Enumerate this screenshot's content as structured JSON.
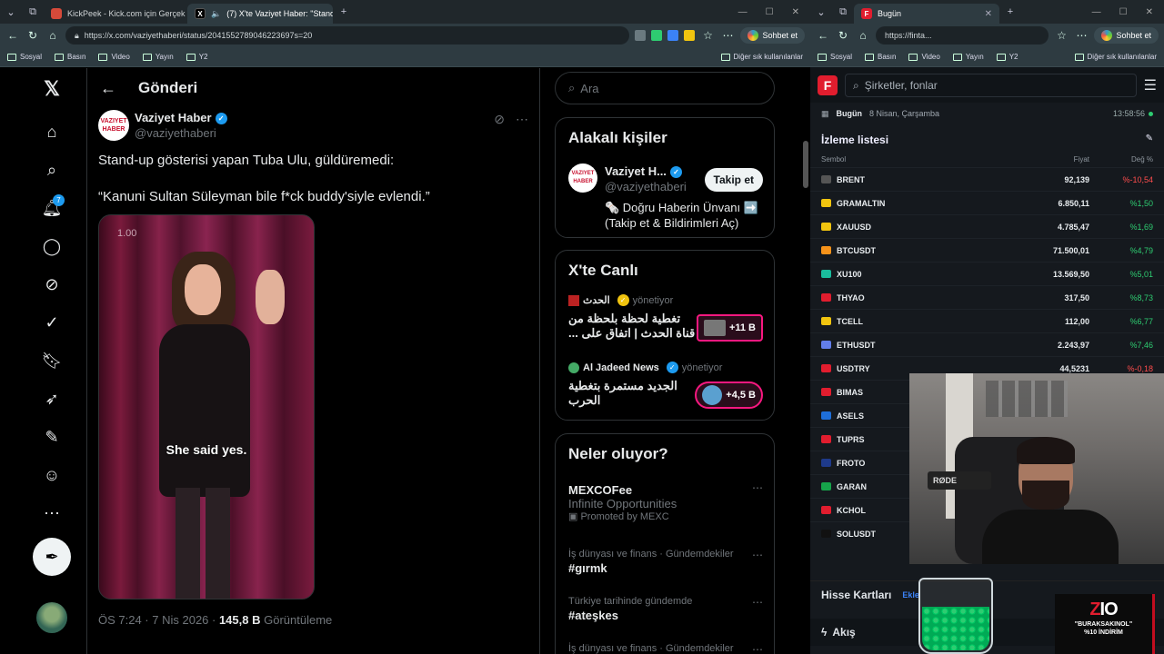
{
  "left_browser": {
    "tabs": [
      {
        "label": "KickPeek - Kick.com için Gerçek Za",
        "fav_color": "#d64a3a",
        "active": false
      },
      {
        "label": "(7) X'te Vaziyet Haber: \"Stand-",
        "fav_color": "#000000",
        "active": true
      }
    ],
    "url": "https://x.com/vaziyethaberi/status/2041552789046223697s=20",
    "copilot": "Sohbet et",
    "bookmarks": [
      "Sosyal",
      "Basın",
      "Video",
      "Yayın",
      "Y2"
    ],
    "bookmarks_other": "Diğer sık kullanılanlar"
  },
  "x": {
    "header_title": "Gönderi",
    "notif_count": "7",
    "author": {
      "name": "Vaziyet Haber",
      "handle": "@vaziyethaberi",
      "logo_text": "VAZIYET HABER"
    },
    "text1": "Stand-up gösterisi yapan Tuba Ulu, güldüremedi:",
    "text2": "“Kanuni Sultan Süleyman bile f*ck buddy'siyle evlendi.”",
    "video_time": "1.00",
    "video_caption": "She said yes.",
    "meta_time": "ÖS 7:24 · 7 Nis 2026 · ",
    "meta_views": "145,8 B",
    "meta_views_label": " Görüntüleme",
    "search_placeholder": "Ara",
    "related_title": "Alakalı kişiler",
    "related": {
      "name": "Vaziyet H...",
      "handle": "@vaziyethaberi",
      "follow": "Takip et",
      "bio": "🗞️ Doğru Haberin Ünvanı ➡️ (Takip et & Bildirimleri Aç)"
    },
    "live_title": "X'te Canlı",
    "live": [
      {
        "source": "الحدث",
        "suffix": "yönetiyor",
        "text": "تغطية لحظة بلحظة من قناة الحدث | اتفاق على ...",
        "count": "+11 B"
      },
      {
        "source": "Al Jadeed News",
        "suffix": "yönetiyor",
        "text": "الجديد مستمرة بتغطية الحرب",
        "count": "+4,5 B"
      }
    ],
    "trends_title": "Neler oluyor?",
    "promo": {
      "title": "MEXCOFee",
      "sub": "Infinite Opportunities",
      "ad": "Promoted by MEXC"
    },
    "trends": [
      {
        "cat": "İş dünyası ve finans · Gündemdekiler",
        "tag": "#gırmk"
      },
      {
        "cat": "Türkiye tarihinde gündemde",
        "tag": "#ateşkes"
      },
      {
        "cat": "İş dünyası ve finans · Gündemdekiler",
        "tag": ""
      }
    ]
  },
  "right_browser": {
    "tab": "Bugün",
    "url": "https://finta...",
    "copilot": "Sohbet et",
    "bookmarks": [
      "Sosyal",
      "Basın",
      "Video",
      "Yayın",
      "Y2"
    ],
    "bookmarks_other": "Diğer sık kullanılanlar"
  },
  "fin": {
    "search_placeholder": "Şirketler, fonlar",
    "today_label": "Bugün",
    "date": "8 Nisan, Çarşamba",
    "time": "13:58:56",
    "watchlist_title": "İzleme listesi",
    "col_symbol": "Sembol",
    "col_price": "Fiyat",
    "col_change": "Değ %",
    "rows": [
      {
        "sym": "BRENT",
        "price": "92,139",
        "chg": "%-10,54",
        "dir": "neg",
        "icon": "#555"
      },
      {
        "sym": "GRAMALTIN",
        "price": "6.850,11",
        "chg": "%1,50",
        "dir": "pos",
        "icon": "#f1c40f"
      },
      {
        "sym": "XAUUSD",
        "price": "4.785,47",
        "chg": "%1,69",
        "dir": "pos",
        "icon": "#f1c40f"
      },
      {
        "sym": "BTCUSDT",
        "price": "71.500,01",
        "chg": "%4,79",
        "dir": "pos",
        "icon": "#f7931a"
      },
      {
        "sym": "XU100",
        "price": "13.569,50",
        "chg": "%5,01",
        "dir": "pos",
        "icon": "#1abc9c"
      },
      {
        "sym": "THYAO",
        "price": "317,50",
        "chg": "%8,73",
        "dir": "pos",
        "icon": "#e11d2e"
      },
      {
        "sym": "TCELL",
        "price": "112,00",
        "chg": "%6,77",
        "dir": "pos",
        "icon": "#f1c40f"
      },
      {
        "sym": "ETHUSDT",
        "price": "2.243,97",
        "chg": "%7,46",
        "dir": "pos",
        "icon": "#627eea"
      },
      {
        "sym": "USDTRY",
        "price": "44,5231",
        "chg": "%-0,18",
        "dir": "neg",
        "icon": "#e11d2e"
      },
      {
        "sym": "BIMAS",
        "price": "",
        "chg": "",
        "dir": "pos",
        "icon": "#e11d2e"
      },
      {
        "sym": "ASELS",
        "price": "",
        "chg": "",
        "dir": "pos",
        "icon": "#1e6fd9"
      },
      {
        "sym": "TUPRS",
        "price": "",
        "chg": "",
        "dir": "pos",
        "icon": "#e11d2e"
      },
      {
        "sym": "FROTO",
        "price": "",
        "chg": "",
        "dir": "pos",
        "icon": "#1e3a8a"
      },
      {
        "sym": "GARAN",
        "price": "",
        "chg": "",
        "dir": "pos",
        "icon": "#16a34a"
      },
      {
        "sym": "KCHOL",
        "price": "",
        "chg": "",
        "dir": "pos",
        "icon": "#e11d2e"
      },
      {
        "sym": "SOLUSDT",
        "price": "",
        "chg": "",
        "dir": "pos",
        "icon": "#111"
      }
    ],
    "hisse_title": "Hisse Kartları",
    "hisse_link": "Ekle",
    "akis": "Akış"
  },
  "overlay": {
    "mic_brand": "RØDE",
    "promo_logo_a": "Z",
    "promo_logo_b": "IO",
    "promo_code": "\"BURAKSAKINOL\"",
    "promo_discount": "%10 İNDİRİM"
  }
}
